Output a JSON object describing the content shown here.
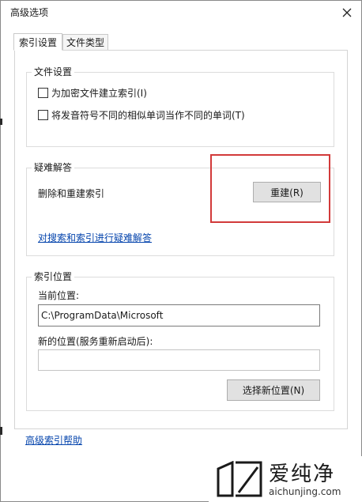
{
  "window": {
    "title": "高级选项"
  },
  "tabs": [
    {
      "label": "索引设置",
      "active": true
    },
    {
      "label": "文件类型",
      "active": false
    }
  ],
  "file_settings": {
    "title": "文件设置",
    "options": [
      {
        "label": "为加密文件建立索引(I)",
        "checked": false
      },
      {
        "label": "将发音符号不同的相似单词当作不同的单词(T)",
        "checked": false
      }
    ]
  },
  "troubleshoot": {
    "title": "疑难解答",
    "rebuild_label": "删除和重建索引",
    "rebuild_button": "重建(R)",
    "help_link": "对搜索和索引进行疑难解答"
  },
  "index_location": {
    "title": "索引位置",
    "current_label": "当前位置:",
    "current_value": "C:\\ProgramData\\Microsoft",
    "new_label": "新的位置(服务重新启动后):",
    "new_value": "",
    "select_button": "选择新位置(N)"
  },
  "footer": {
    "help_link": "高级索引帮助"
  },
  "watermark": {
    "text": "爱纯净",
    "url": "aichunjing.com"
  },
  "colors": {
    "highlight": "#d23a3a",
    "link": "#0645ad"
  }
}
